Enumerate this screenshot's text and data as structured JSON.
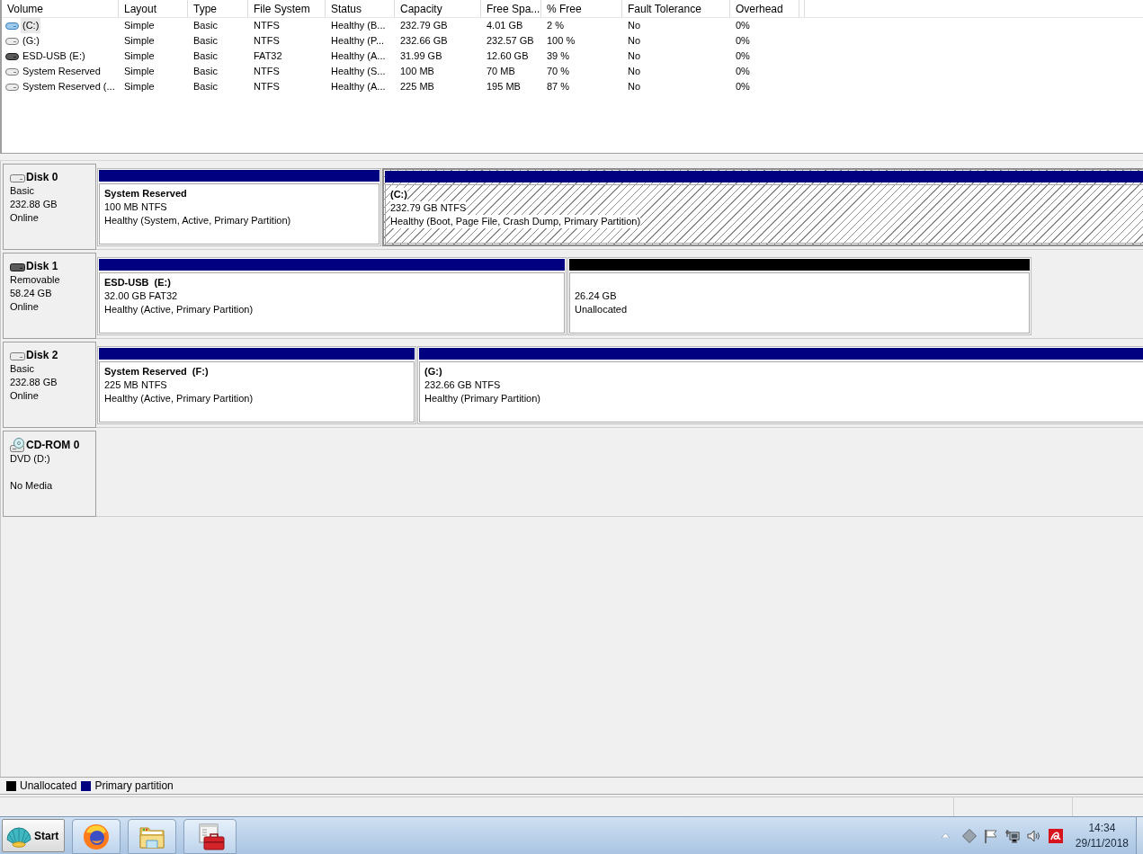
{
  "volume_list": {
    "columns": [
      "Volume",
      "Layout",
      "Type",
      "File System",
      "Status",
      "Capacity",
      "Free Spa...",
      "% Free",
      "Fault Tolerance",
      "Overhead"
    ],
    "rows": [
      {
        "kind": "system",
        "selected": true,
        "cells": [
          "(C:)",
          "Simple",
          "Basic",
          "NTFS",
          "Healthy (B...",
          "232.79 GB",
          "4.01 GB",
          "2 %",
          "No",
          "0%"
        ]
      },
      {
        "kind": "fixed",
        "selected": false,
        "cells": [
          "(G:)",
          "Simple",
          "Basic",
          "NTFS",
          "Healthy (P...",
          "232.66 GB",
          "232.57 GB",
          "100 %",
          "No",
          "0%"
        ]
      },
      {
        "kind": "removable",
        "selected": false,
        "cells": [
          "ESD-USB (E:)",
          "Simple",
          "Basic",
          "FAT32",
          "Healthy (A...",
          "31.99 GB",
          "12.60 GB",
          "39 %",
          "No",
          "0%"
        ]
      },
      {
        "kind": "fixed",
        "selected": false,
        "cells": [
          "System Reserved",
          "Simple",
          "Basic",
          "NTFS",
          "Healthy (S...",
          "100 MB",
          "70 MB",
          "70 %",
          "No",
          "0%"
        ]
      },
      {
        "kind": "fixed",
        "selected": false,
        "cells": [
          "System Reserved (...",
          "Simple",
          "Basic",
          "NTFS",
          "Healthy (A...",
          "225 MB",
          "195 MB",
          "87 %",
          "No",
          "0%"
        ]
      }
    ]
  },
  "disks": [
    {
      "kind": "fixed",
      "name": "Disk 0",
      "type": "Basic",
      "size": "232.88 GB",
      "status": "Online",
      "partitions": [
        {
          "kind": "primary",
          "selected": false,
          "name": "System Reserved",
          "size": "100 MB NTFS",
          "status": "Healthy (System, Active, Primary Partition)"
        },
        {
          "kind": "primary",
          "selected": true,
          "name": "(C:)",
          "size": "232.79 GB NTFS",
          "status": "Healthy (Boot, Page File, Crash Dump, Primary Partition)"
        }
      ]
    },
    {
      "kind": "removable",
      "name": "Disk 1",
      "type": "Removable",
      "size": "58.24 GB",
      "status": "Online",
      "partitions": [
        {
          "kind": "primary",
          "selected": false,
          "name": "ESD-USB  (E:)",
          "size": "32.00 GB FAT32",
          "status": "Healthy (Active, Primary Partition)"
        },
        {
          "kind": "unallocated",
          "selected": false,
          "size": "26.24 GB",
          "status": "Unallocated"
        }
      ]
    },
    {
      "kind": "fixed",
      "name": "Disk 2",
      "type": "Basic",
      "size": "232.88 GB",
      "status": "Online",
      "partitions": [
        {
          "kind": "primary",
          "selected": false,
          "name": "System Reserved  (F:)",
          "size": "225 MB NTFS",
          "status": "Healthy (Active, Primary Partition)"
        },
        {
          "kind": "primary",
          "selected": false,
          "name": "(G:)",
          "size": "232.66 GB NTFS",
          "status": "Healthy (Primary Partition)"
        }
      ]
    },
    {
      "kind": "cdrom",
      "name": "CD-ROM 0",
      "type": "DVD (D:)",
      "status": "No Media"
    }
  ],
  "legend": [
    {
      "label": "Unallocated",
      "color": "#000000"
    },
    {
      "label": "Primary partition",
      "color": "#000080"
    }
  ],
  "taskbar": {
    "start": {
      "label": "Start"
    },
    "clock": {
      "time": "14:34",
      "date": "29/11/2018"
    }
  }
}
